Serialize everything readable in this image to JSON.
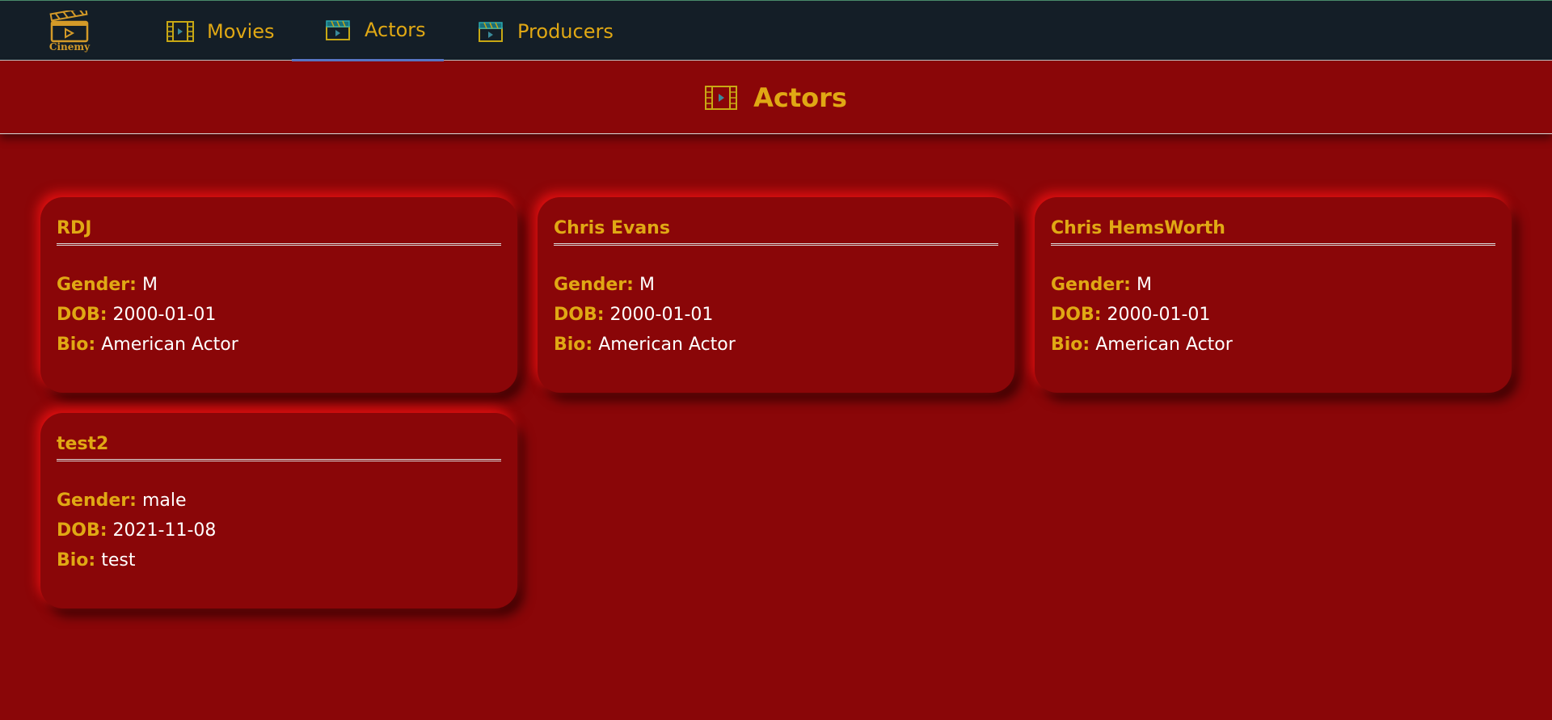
{
  "brand": {
    "logo_text": "Cinemy"
  },
  "nav": {
    "items": [
      {
        "label": "Movies"
      },
      {
        "label": "Actors"
      },
      {
        "label": "Producers"
      }
    ]
  },
  "page": {
    "title": "Actors"
  },
  "labels": {
    "gender": "Gender:",
    "dob": "DOB:",
    "bio": "Bio:"
  },
  "actors": [
    {
      "name": "RDJ",
      "gender": "M",
      "dob": "2000-01-01",
      "bio": "American Actor"
    },
    {
      "name": "Chris Evans",
      "gender": "M",
      "dob": "2000-01-01",
      "bio": "American Actor"
    },
    {
      "name": "Chris HemsWorth",
      "gender": "M",
      "dob": "2000-01-01",
      "bio": "American Actor"
    },
    {
      "name": "test2",
      "gender": "male",
      "dob": "2021-11-08",
      "bio": "test"
    }
  ],
  "colors": {
    "background": "#8a0608",
    "navbar": "#141e27",
    "accent": "#e0a814",
    "active_tab_underline": "#5b78c9"
  }
}
